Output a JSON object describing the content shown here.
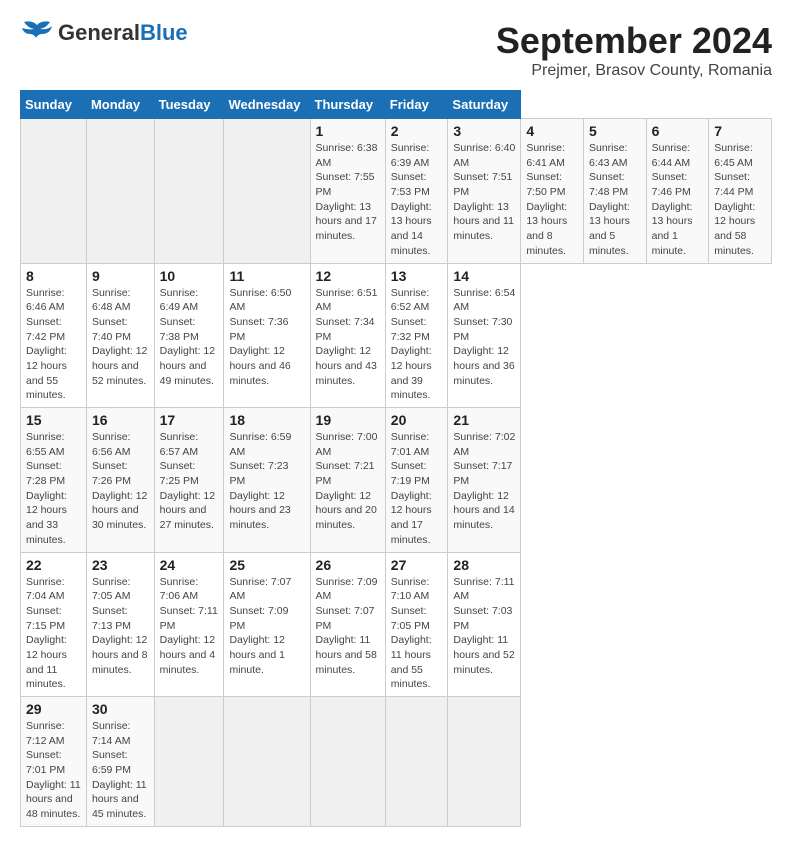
{
  "header": {
    "logo": {
      "general": "General",
      "blue": "Blue"
    },
    "title": "September 2024",
    "subtitle": "Prejmer, Brasov County, Romania"
  },
  "calendar": {
    "days_of_week": [
      "Sunday",
      "Monday",
      "Tuesday",
      "Wednesday",
      "Thursday",
      "Friday",
      "Saturday"
    ],
    "weeks": [
      [
        null,
        null,
        null,
        null,
        {
          "day": 1,
          "sunrise": "Sunrise: 6:38 AM",
          "sunset": "Sunset: 7:55 PM",
          "daylight": "Daylight: 13 hours and 17 minutes."
        },
        {
          "day": 2,
          "sunrise": "Sunrise: 6:39 AM",
          "sunset": "Sunset: 7:53 PM",
          "daylight": "Daylight: 13 hours and 14 minutes."
        },
        {
          "day": 3,
          "sunrise": "Sunrise: 6:40 AM",
          "sunset": "Sunset: 7:51 PM",
          "daylight": "Daylight: 13 hours and 11 minutes."
        },
        {
          "day": 4,
          "sunrise": "Sunrise: 6:41 AM",
          "sunset": "Sunset: 7:50 PM",
          "daylight": "Daylight: 13 hours and 8 minutes."
        },
        {
          "day": 5,
          "sunrise": "Sunrise: 6:43 AM",
          "sunset": "Sunset: 7:48 PM",
          "daylight": "Daylight: 13 hours and 5 minutes."
        },
        {
          "day": 6,
          "sunrise": "Sunrise: 6:44 AM",
          "sunset": "Sunset: 7:46 PM",
          "daylight": "Daylight: 13 hours and 1 minute."
        },
        {
          "day": 7,
          "sunrise": "Sunrise: 6:45 AM",
          "sunset": "Sunset: 7:44 PM",
          "daylight": "Daylight: 12 hours and 58 minutes."
        }
      ],
      [
        {
          "day": 8,
          "sunrise": "Sunrise: 6:46 AM",
          "sunset": "Sunset: 7:42 PM",
          "daylight": "Daylight: 12 hours and 55 minutes."
        },
        {
          "day": 9,
          "sunrise": "Sunrise: 6:48 AM",
          "sunset": "Sunset: 7:40 PM",
          "daylight": "Daylight: 12 hours and 52 minutes."
        },
        {
          "day": 10,
          "sunrise": "Sunrise: 6:49 AM",
          "sunset": "Sunset: 7:38 PM",
          "daylight": "Daylight: 12 hours and 49 minutes."
        },
        {
          "day": 11,
          "sunrise": "Sunrise: 6:50 AM",
          "sunset": "Sunset: 7:36 PM",
          "daylight": "Daylight: 12 hours and 46 minutes."
        },
        {
          "day": 12,
          "sunrise": "Sunrise: 6:51 AM",
          "sunset": "Sunset: 7:34 PM",
          "daylight": "Daylight: 12 hours and 43 minutes."
        },
        {
          "day": 13,
          "sunrise": "Sunrise: 6:52 AM",
          "sunset": "Sunset: 7:32 PM",
          "daylight": "Daylight: 12 hours and 39 minutes."
        },
        {
          "day": 14,
          "sunrise": "Sunrise: 6:54 AM",
          "sunset": "Sunset: 7:30 PM",
          "daylight": "Daylight: 12 hours and 36 minutes."
        }
      ],
      [
        {
          "day": 15,
          "sunrise": "Sunrise: 6:55 AM",
          "sunset": "Sunset: 7:28 PM",
          "daylight": "Daylight: 12 hours and 33 minutes."
        },
        {
          "day": 16,
          "sunrise": "Sunrise: 6:56 AM",
          "sunset": "Sunset: 7:26 PM",
          "daylight": "Daylight: 12 hours and 30 minutes."
        },
        {
          "day": 17,
          "sunrise": "Sunrise: 6:57 AM",
          "sunset": "Sunset: 7:25 PM",
          "daylight": "Daylight: 12 hours and 27 minutes."
        },
        {
          "day": 18,
          "sunrise": "Sunrise: 6:59 AM",
          "sunset": "Sunset: 7:23 PM",
          "daylight": "Daylight: 12 hours and 23 minutes."
        },
        {
          "day": 19,
          "sunrise": "Sunrise: 7:00 AM",
          "sunset": "Sunset: 7:21 PM",
          "daylight": "Daylight: 12 hours and 20 minutes."
        },
        {
          "day": 20,
          "sunrise": "Sunrise: 7:01 AM",
          "sunset": "Sunset: 7:19 PM",
          "daylight": "Daylight: 12 hours and 17 minutes."
        },
        {
          "day": 21,
          "sunrise": "Sunrise: 7:02 AM",
          "sunset": "Sunset: 7:17 PM",
          "daylight": "Daylight: 12 hours and 14 minutes."
        }
      ],
      [
        {
          "day": 22,
          "sunrise": "Sunrise: 7:04 AM",
          "sunset": "Sunset: 7:15 PM",
          "daylight": "Daylight: 12 hours and 11 minutes."
        },
        {
          "day": 23,
          "sunrise": "Sunrise: 7:05 AM",
          "sunset": "Sunset: 7:13 PM",
          "daylight": "Daylight: 12 hours and 8 minutes."
        },
        {
          "day": 24,
          "sunrise": "Sunrise: 7:06 AM",
          "sunset": "Sunset: 7:11 PM",
          "daylight": "Daylight: 12 hours and 4 minutes."
        },
        {
          "day": 25,
          "sunrise": "Sunrise: 7:07 AM",
          "sunset": "Sunset: 7:09 PM",
          "daylight": "Daylight: 12 hours and 1 minute."
        },
        {
          "day": 26,
          "sunrise": "Sunrise: 7:09 AM",
          "sunset": "Sunset: 7:07 PM",
          "daylight": "Daylight: 11 hours and 58 minutes."
        },
        {
          "day": 27,
          "sunrise": "Sunrise: 7:10 AM",
          "sunset": "Sunset: 7:05 PM",
          "daylight": "Daylight: 11 hours and 55 minutes."
        },
        {
          "day": 28,
          "sunrise": "Sunrise: 7:11 AM",
          "sunset": "Sunset: 7:03 PM",
          "daylight": "Daylight: 11 hours and 52 minutes."
        }
      ],
      [
        {
          "day": 29,
          "sunrise": "Sunrise: 7:12 AM",
          "sunset": "Sunset: 7:01 PM",
          "daylight": "Daylight: 11 hours and 48 minutes."
        },
        {
          "day": 30,
          "sunrise": "Sunrise: 7:14 AM",
          "sunset": "Sunset: 6:59 PM",
          "daylight": "Daylight: 11 hours and 45 minutes."
        },
        null,
        null,
        null,
        null,
        null
      ]
    ]
  }
}
